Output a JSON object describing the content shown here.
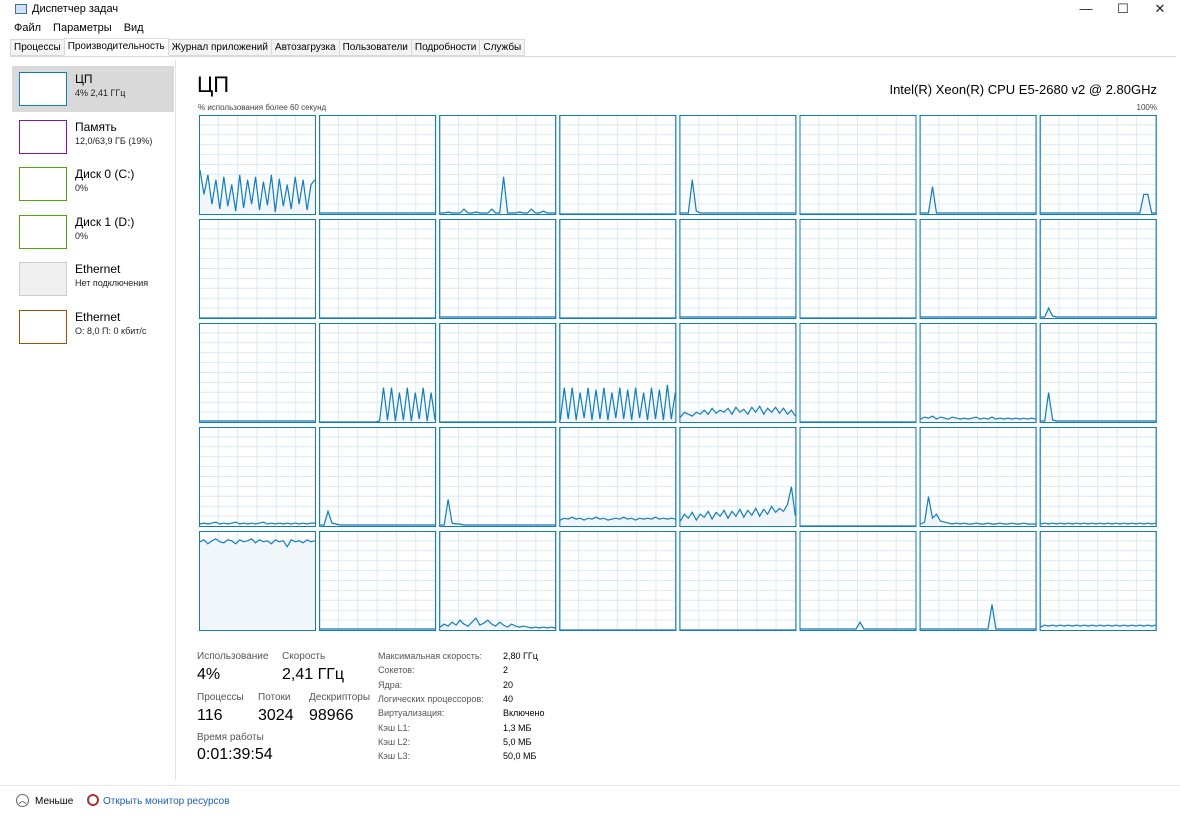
{
  "window": {
    "title": "Диспетчер задач",
    "minimize": "—",
    "maximize": "☐",
    "close": "✕"
  },
  "menu": [
    "Файл",
    "Параметры",
    "Вид"
  ],
  "tabs": [
    "Процессы",
    "Производительность",
    "Журнал приложений",
    "Автозагрузка",
    "Пользователи",
    "Подробности",
    "Службы"
  ],
  "active_tab": 1,
  "sidebar": [
    {
      "name": "ЦП",
      "sub": "4% 2,41 ГГц",
      "color": "#117dbb"
    },
    {
      "name": "Память",
      "sub": "12,0/63,9 ГБ (19%)",
      "color": "#8b12ae"
    },
    {
      "name": "Диск 0 (C:)",
      "sub": "0%",
      "color": "#4da60c"
    },
    {
      "name": "Диск 1 (D:)",
      "sub": "0%",
      "color": "#4da60c"
    },
    {
      "name": "Ethernet",
      "sub": "Нет подключения",
      "color": "#cccccc"
    },
    {
      "name": "Ethernet",
      "sub": "О: 8,0 П: 0 кбит/с",
      "color": "#a74f01"
    }
  ],
  "main": {
    "title": "ЦП",
    "cpu_name": "Intel(R) Xeon(R) CPU E5-2680 v2 @ 2.80GHz",
    "axis_label": "% использования более 60 секунд",
    "axis_max": "100%"
  },
  "stats": {
    "usage_label": "Использование",
    "usage": "4%",
    "speed_label": "Скорость",
    "speed": "2,41 ГГц",
    "processes_label": "Процессы",
    "processes": "116",
    "threads_label": "Потоки",
    "threads": "3024",
    "handles_label": "Дескрипторы",
    "handles": "98966",
    "uptime_label": "Время работы",
    "uptime": "0:01:39:54"
  },
  "specs": [
    {
      "k": "Максимальная скорость:",
      "v": "2,80 ГГц"
    },
    {
      "k": "Сокетов:",
      "v": "2"
    },
    {
      "k": "Ядра:",
      "v": "20"
    },
    {
      "k": "Логических процессоров:",
      "v": "40"
    },
    {
      "k": "Виртуализация:",
      "v": "Включено"
    },
    {
      "k": "Кэш L1:",
      "v": "1,3 МБ"
    },
    {
      "k": "Кэш L2:",
      "v": "5,0 МБ"
    },
    {
      "k": "Кэш L3:",
      "v": "50,0 МБ"
    }
  ],
  "footer": {
    "less": "Меньше",
    "resource_monitor": "Открыть монитор ресурсов"
  },
  "chart_data": {
    "type": "line",
    "grid": true,
    "ylim": [
      0,
      100
    ],
    "color": "#117dbb",
    "cores": [
      [
        45,
        20,
        40,
        10,
        35,
        5,
        38,
        8,
        30,
        3,
        40,
        6,
        35,
        10,
        38,
        4,
        33,
        9,
        40,
        2,
        36,
        8,
        30,
        5,
        38,
        10,
        35,
        4,
        30,
        35
      ],
      [
        1,
        1,
        1,
        1,
        1,
        1,
        1,
        1,
        1,
        1,
        1,
        1,
        1,
        1,
        1,
        1,
        1,
        1,
        1,
        1,
        1,
        1,
        1,
        1,
        1,
        1,
        1,
        1,
        1,
        1
      ],
      [
        1,
        1,
        2,
        1,
        1,
        1,
        5,
        1,
        1,
        2,
        1,
        1,
        1,
        5,
        1,
        1,
        38,
        1,
        1,
        1,
        2,
        1,
        1,
        5,
        1,
        1,
        3,
        1,
        1,
        1
      ],
      [
        0,
        0,
        0,
        0,
        0,
        0,
        0,
        0,
        0,
        0,
        0,
        0,
        0,
        0,
        0,
        0,
        0,
        0,
        0,
        0,
        0,
        0,
        0,
        0,
        0,
        0,
        0,
        0,
        0,
        0
      ],
      [
        1,
        1,
        1,
        35,
        3,
        1,
        1,
        1,
        1,
        1,
        1,
        1,
        1,
        1,
        1,
        1,
        1,
        1,
        1,
        1,
        1,
        1,
        1,
        1,
        1,
        1,
        1,
        1,
        1,
        1
      ],
      [
        0,
        0,
        0,
        0,
        0,
        0,
        0,
        0,
        0,
        0,
        0,
        0,
        0,
        0,
        0,
        0,
        0,
        0,
        0,
        0,
        0,
        0,
        0,
        0,
        0,
        0,
        0,
        0,
        0,
        0
      ],
      [
        1,
        1,
        1,
        28,
        1,
        1,
        1,
        1,
        1,
        1,
        1,
        1,
        1,
        1,
        1,
        1,
        1,
        1,
        1,
        1,
        1,
        1,
        1,
        1,
        1,
        1,
        1,
        1,
        1,
        1
      ],
      [
        1,
        1,
        1,
        1,
        1,
        1,
        1,
        1,
        1,
        1,
        1,
        1,
        1,
        1,
        1,
        1,
        1,
        1,
        1,
        1,
        1,
        1,
        1,
        1,
        1,
        1,
        20,
        20,
        1,
        1
      ],
      [
        0,
        0,
        0,
        0,
        0,
        0,
        0,
        0,
        0,
        0,
        0,
        0,
        0,
        0,
        0,
        0,
        0,
        0,
        0,
        0,
        0,
        0,
        0,
        0,
        0,
        0,
        0,
        0,
        0,
        0
      ],
      [
        0,
        0,
        0,
        0,
        0,
        0,
        0,
        0,
        0,
        0,
        0,
        0,
        0,
        0,
        0,
        0,
        0,
        0,
        0,
        0,
        0,
        0,
        0,
        0,
        0,
        0,
        0,
        0,
        0,
        0
      ],
      [
        1,
        1,
        1,
        1,
        1,
        1,
        1,
        1,
        1,
        1,
        1,
        1,
        1,
        1,
        1,
        1,
        1,
        1,
        1,
        1,
        1,
        1,
        1,
        1,
        1,
        1,
        1,
        1,
        1,
        1
      ],
      [
        0,
        0,
        0,
        0,
        0,
        0,
        0,
        0,
        0,
        0,
        0,
        0,
        0,
        0,
        0,
        0,
        0,
        0,
        0,
        0,
        0,
        0,
        0,
        0,
        0,
        0,
        0,
        0,
        0,
        0
      ],
      [
        1,
        1,
        1,
        1,
        1,
        1,
        1,
        1,
        1,
        1,
        1,
        1,
        1,
        1,
        1,
        1,
        1,
        1,
        1,
        1,
        1,
        1,
        1,
        1,
        1,
        1,
        1,
        1,
        1,
        1
      ],
      [
        0,
        0,
        0,
        0,
        0,
        0,
        0,
        0,
        0,
        0,
        0,
        0,
        0,
        0,
        0,
        0,
        0,
        0,
        0,
        0,
        0,
        0,
        0,
        0,
        0,
        0,
        0,
        0,
        0,
        0
      ],
      [
        1,
        1,
        1,
        1,
        1,
        1,
        1,
        1,
        1,
        1,
        1,
        1,
        1,
        1,
        1,
        1,
        1,
        1,
        1,
        1,
        1,
        1,
        1,
        1,
        1,
        1,
        1,
        1,
        1,
        1
      ],
      [
        1,
        1,
        10,
        2,
        1,
        1,
        1,
        1,
        1,
        1,
        1,
        1,
        1,
        1,
        1,
        1,
        1,
        1,
        1,
        1,
        1,
        1,
        1,
        1,
        1,
        1,
        1,
        1,
        1,
        1
      ],
      [
        1,
        1,
        1,
        1,
        1,
        1,
        1,
        1,
        1,
        1,
        1,
        1,
        1,
        1,
        1,
        1,
        1,
        1,
        1,
        1,
        1,
        1,
        1,
        1,
        1,
        1,
        1,
        1,
        1,
        1
      ],
      [
        0,
        0,
        0,
        0,
        0,
        0,
        0,
        0,
        0,
        0,
        0,
        0,
        0,
        0,
        0,
        1,
        35,
        2,
        35,
        1,
        30,
        2,
        35,
        1,
        30,
        3,
        35,
        1,
        30,
        2
      ],
      [
        0,
        0,
        0,
        0,
        0,
        0,
        0,
        0,
        0,
        0,
        0,
        0,
        0,
        0,
        0,
        0,
        0,
        0,
        0,
        0,
        0,
        0,
        0,
        0,
        0,
        0,
        0,
        0,
        0,
        0
      ],
      [
        2,
        35,
        3,
        35,
        2,
        30,
        4,
        35,
        2,
        33,
        3,
        35,
        2,
        30,
        4,
        35,
        3,
        33,
        2,
        35,
        4,
        30,
        2,
        35,
        3,
        33,
        2,
        38,
        3,
        30
      ],
      [
        5,
        10,
        8,
        6,
        10,
        8,
        12,
        8,
        14,
        9,
        12,
        10,
        14,
        8,
        15,
        10,
        13,
        8,
        15,
        10,
        16,
        8,
        14,
        10,
        15,
        9,
        14,
        8,
        12,
        6
      ],
      [
        0,
        0,
        0,
        0,
        0,
        0,
        0,
        0,
        0,
        0,
        0,
        0,
        0,
        0,
        0,
        0,
        0,
        0,
        0,
        0,
        0,
        0,
        0,
        0,
        0,
        0,
        0,
        0,
        0,
        0
      ],
      [
        3,
        5,
        4,
        6,
        3,
        5,
        4,
        3,
        5,
        4,
        3,
        4,
        3,
        4,
        5,
        3,
        4,
        3,
        5,
        3,
        4,
        3,
        4,
        3,
        4,
        3,
        4,
        3,
        4,
        3
      ],
      [
        1,
        1,
        30,
        2,
        1,
        1,
        1,
        1,
        1,
        1,
        1,
        1,
        1,
        1,
        1,
        1,
        1,
        1,
        1,
        1,
        1,
        1,
        1,
        1,
        1,
        1,
        1,
        1,
        1,
        1
      ],
      [
        2,
        3,
        2,
        3,
        4,
        2,
        3,
        2,
        3,
        4,
        2,
        3,
        2,
        3,
        2,
        3,
        4,
        2,
        3,
        2,
        3,
        2,
        3,
        2,
        3,
        2,
        3,
        2,
        3,
        3
      ],
      [
        1,
        1,
        15,
        3,
        2,
        1,
        1,
        1,
        1,
        1,
        1,
        1,
        1,
        1,
        1,
        1,
        1,
        1,
        1,
        1,
        1,
        1,
        1,
        1,
        1,
        1,
        1,
        1,
        1,
        1
      ],
      [
        1,
        1,
        27,
        3,
        2,
        2,
        1,
        1,
        1,
        1,
        1,
        1,
        1,
        1,
        1,
        1,
        1,
        1,
        1,
        1,
        1,
        1,
        1,
        1,
        1,
        1,
        1,
        1,
        1,
        1
      ],
      [
        6,
        8,
        7,
        9,
        7,
        8,
        6,
        8,
        7,
        9,
        7,
        8,
        6,
        7,
        8,
        7,
        9,
        7,
        8,
        6,
        8,
        7,
        8,
        7,
        9,
        7,
        8,
        7,
        8,
        7
      ],
      [
        5,
        12,
        8,
        14,
        6,
        12,
        9,
        15,
        7,
        14,
        10,
        16,
        8,
        15,
        10,
        17,
        9,
        16,
        11,
        18,
        10,
        17,
        12,
        20,
        14,
        18,
        15,
        22,
        40,
        10
      ],
      [
        0,
        0,
        0,
        0,
        0,
        0,
        0,
        0,
        0,
        0,
        0,
        0,
        0,
        0,
        0,
        0,
        0,
        0,
        0,
        0,
        0,
        0,
        0,
        0,
        0,
        0,
        0,
        0,
        0,
        0
      ],
      [
        2,
        4,
        30,
        8,
        12,
        5,
        4,
        3,
        2,
        3,
        2,
        3,
        2,
        2,
        3,
        2,
        2,
        3,
        2,
        2,
        3,
        2,
        2,
        3,
        2,
        2,
        3,
        2,
        2,
        2
      ],
      [
        2,
        3,
        2,
        3,
        2,
        3,
        2,
        3,
        2,
        3,
        2,
        3,
        2,
        3,
        2,
        3,
        2,
        3,
        2,
        3,
        2,
        3,
        2,
        3,
        2,
        3,
        2,
        3,
        2,
        3
      ],
      [
        90,
        92,
        88,
        91,
        93,
        90,
        89,
        92,
        91,
        88,
        92,
        90,
        91,
        93,
        89,
        92,
        90,
        91,
        88,
        92,
        90,
        91,
        85,
        92,
        90,
        91,
        89,
        92,
        90,
        91
      ],
      [
        1,
        1,
        1,
        1,
        1,
        1,
        1,
        1,
        1,
        1,
        1,
        1,
        1,
        1,
        1,
        1,
        1,
        1,
        1,
        1,
        1,
        1,
        1,
        1,
        1,
        1,
        1,
        1,
        1,
        1
      ],
      [
        3,
        6,
        4,
        8,
        5,
        10,
        6,
        4,
        8,
        12,
        5,
        7,
        10,
        6,
        4,
        8,
        5,
        3,
        6,
        4,
        3,
        4,
        3,
        2,
        3,
        2,
        3,
        2,
        3,
        2
      ],
      [
        0,
        0,
        0,
        0,
        0,
        0,
        0,
        0,
        0,
        0,
        0,
        0,
        0,
        0,
        0,
        0,
        0,
        0,
        0,
        0,
        0,
        0,
        0,
        0,
        0,
        0,
        0,
        0,
        0,
        0
      ],
      [
        0,
        0,
        0,
        0,
        0,
        0,
        0,
        0,
        0,
        0,
        0,
        0,
        0,
        0,
        0,
        0,
        0,
        0,
        0,
        0,
        0,
        0,
        0,
        0,
        0,
        0,
        0,
        0,
        0,
        0
      ],
      [
        1,
        1,
        1,
        1,
        1,
        1,
        1,
        1,
        1,
        1,
        1,
        1,
        1,
        1,
        1,
        8,
        1,
        1,
        1,
        1,
        1,
        1,
        1,
        1,
        1,
        1,
        1,
        1,
        1,
        1
      ],
      [
        1,
        1,
        1,
        1,
        1,
        1,
        1,
        1,
        1,
        1,
        1,
        1,
        1,
        1,
        1,
        1,
        1,
        1,
        26,
        1,
        1,
        1,
        1,
        1,
        1,
        1,
        1,
        1,
        1,
        1
      ],
      [
        3,
        5,
        4,
        5,
        4,
        5,
        4,
        5,
        4,
        5,
        4,
        5,
        4,
        5,
        4,
        5,
        4,
        5,
        4,
        5,
        4,
        5,
        4,
        5,
        4,
        5,
        4,
        5,
        4,
        5
      ]
    ]
  }
}
